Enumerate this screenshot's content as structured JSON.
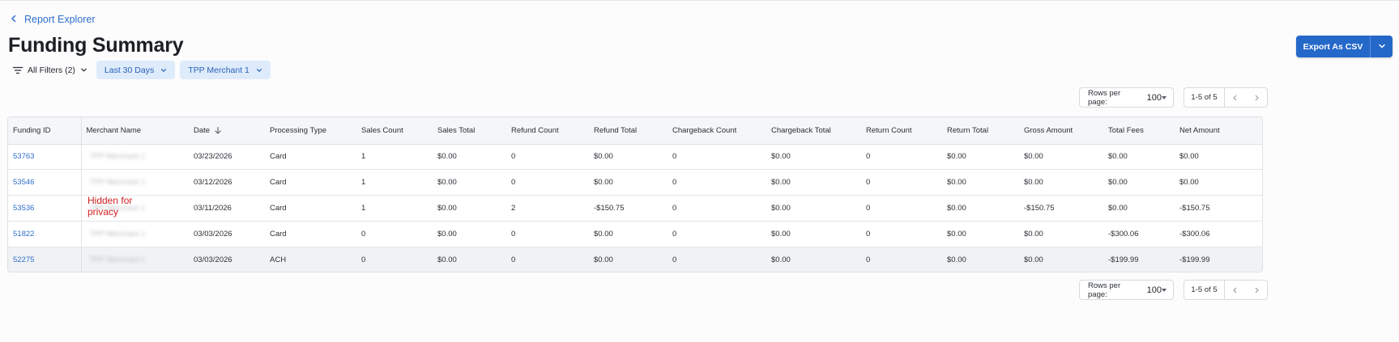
{
  "nav": {
    "back_label": "Report Explorer"
  },
  "page": {
    "title": "Funding Summary"
  },
  "toolbar": {
    "export_label": "Export As CSV"
  },
  "filters": {
    "all_filters_label": "All Filters (2)",
    "chips": [
      "Last 30 Days",
      "TPP Merchant 1"
    ]
  },
  "pagination": {
    "rows_per_page_label": "Rows per page:",
    "rows_per_page_value": "100",
    "range": "1-5 of 5"
  },
  "table": {
    "columns": [
      "Funding ID",
      "Merchant Name",
      "Date",
      "Processing Type",
      "Sales Count",
      "Sales Total",
      "Refund Count",
      "Refund Total",
      "Chargeback Count",
      "Chargeback Total",
      "Return Count",
      "Return Total",
      "Gross Amount",
      "Total Fees",
      "Net Amount"
    ],
    "rows": [
      [
        "53763",
        "TPP Merchant 1",
        "03/23/2026",
        "Card",
        "1",
        "$0.00",
        "0",
        "$0.00",
        "0",
        "$0.00",
        "0",
        "$0.00",
        "$0.00",
        "$0.00",
        "$0.00"
      ],
      [
        "53546",
        "TPP Merchant 1",
        "03/12/2026",
        "Card",
        "1",
        "$0.00",
        "0",
        "$0.00",
        "0",
        "$0.00",
        "0",
        "$0.00",
        "$0.00",
        "$0.00",
        "$0.00"
      ],
      [
        "53536",
        "TPP Merchant 1",
        "03/11/2026",
        "Card",
        "1",
        "$0.00",
        "2",
        "-$150.75",
        "0",
        "$0.00",
        "0",
        "$0.00",
        "-$150.75",
        "$0.00",
        "-$150.75"
      ],
      [
        "51822",
        "TPP Merchant 1",
        "03/03/2026",
        "Card",
        "0",
        "$0.00",
        "0",
        "$0.00",
        "0",
        "$0.00",
        "0",
        "$0.00",
        "$0.00",
        "-$300.06",
        "-$300.06"
      ],
      [
        "52275",
        "TPP Merchant 1",
        "03/03/2026",
        "ACH",
        "0",
        "$0.00",
        "0",
        "$0.00",
        "0",
        "$0.00",
        "0",
        "$0.00",
        "$0.00",
        "-$199.99",
        "-$199.99"
      ]
    ]
  },
  "annotation": {
    "privacy_note": "Hidden for privacy"
  },
  "colors": {
    "accent": "#2468c9",
    "link": "#2f6fcc",
    "chip_bg": "#deebfb",
    "annotation": "#d11f1f"
  },
  "icons": {
    "back": "chevron-left-icon",
    "filter": "filter-lines-icon",
    "sort": "arrow-down-icon"
  }
}
